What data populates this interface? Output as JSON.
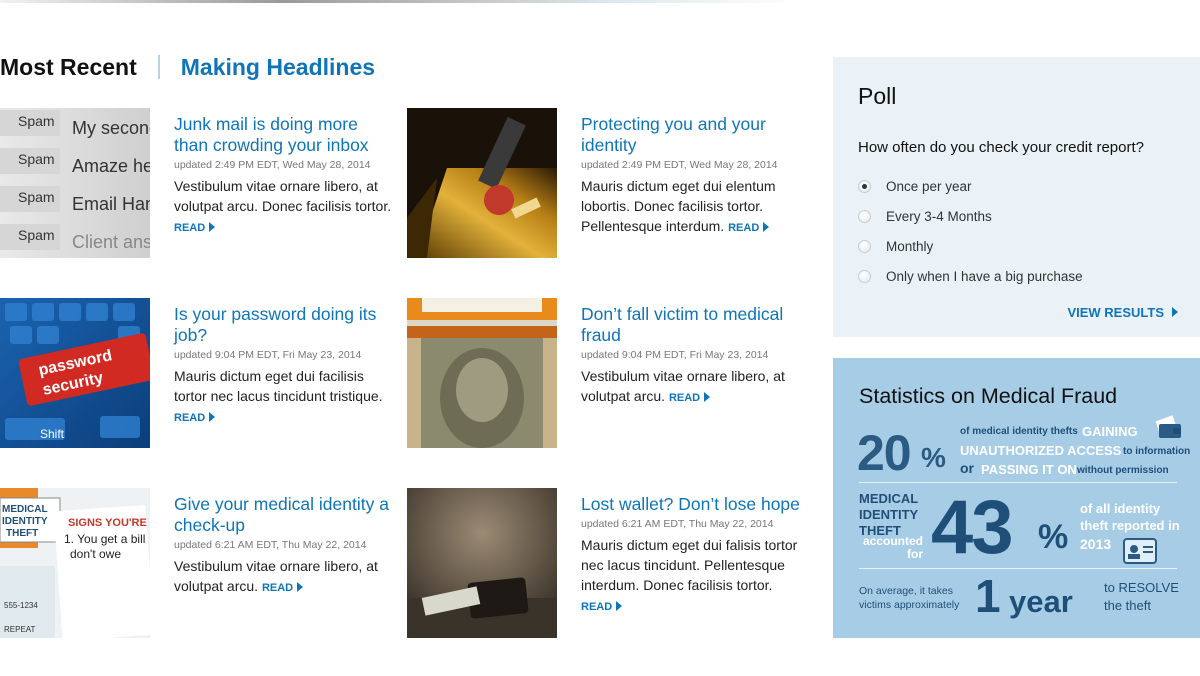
{
  "tabs": {
    "most_recent": "Most Recent",
    "making_headlines": "Making Headlines"
  },
  "articles": [
    {
      "title": "Junk mail is doing more than crowding your inbox",
      "date": "updated 2:49 PM EDT, Wed May 28, 2014",
      "body": "Vestibulum vitae ornare libero, at volutpat arcu. Donec facilisis tortor.",
      "read": "READ",
      "image": {
        "words": [
          "Spam",
          "My second",
          "Spam",
          "Amaze her",
          "Spam",
          "Email Hand",
          "Spam",
          "Client answ"
        ]
      }
    },
    {
      "title": "Protecting you and your identity",
      "date": "updated 2:49 PM EDT, Wed May 28, 2014",
      "body": "Mauris dictum eget dui elentum lobortis. Donec facilisis tortor. Pellentesque interdum.",
      "read": "READ",
      "image": {
        "text": ""
      }
    },
    {
      "title": "Is your password doing its job?",
      "date": "updated 9:04 PM EDT, Fri May 23, 2014",
      "body": "Mauris dictum eget dui facilisis tortor nec lacus tincidunt tristique.",
      "read": "READ",
      "image": {
        "key_top": "password",
        "key_bottom": "security",
        "shift": "Shift"
      }
    },
    {
      "title": "Don’t fall victim to medical fraud",
      "date": "updated 9:04 PM EDT, Fri May 23, 2014",
      "body": "Vestibulum vitae ornare libero, at volutpat arcu.",
      "read": "READ",
      "image": {
        "text": ""
      }
    },
    {
      "title": "Give your medical identity a check-up",
      "date": "updated 6:21 AM EDT, Thu May 22, 2014",
      "body": "Vestibulum vitae ornare libero, at volutpat arcu.",
      "read": "READ",
      "image": {
        "label1": "MEDICAL",
        "label2": "IDENTITY",
        "label3": "THEFT",
        "sign": "SIGNS YOU'RE A",
        "note1": "1. You get a bill",
        "note2": "don't owe",
        "num": "555-1234",
        "repeat": "REPEAT"
      }
    },
    {
      "title": "Lost wallet? Don’t lose hope",
      "date": "updated 6:21 AM EDT, Thu May 22, 2014",
      "body": "Mauris dictum eget dui falisis tortor nec lacus tincidunt. Pellentesque interdum. Donec facilisis tortor.",
      "read": "READ",
      "image": {
        "text": ""
      }
    }
  ],
  "poll": {
    "title": "Poll",
    "question": "How often do you check your credit report?",
    "options": [
      "Once per year",
      "Every 3-4 Months",
      "Monthly",
      "Only when I have a big purchase"
    ],
    "selected": 0,
    "view_results": "VIEW RESULTS"
  },
  "stats": {
    "title": "Statistics on Medical Fraud",
    "stat1": {
      "big": "20",
      "pct": "%",
      "line1": "of medical identity thefts",
      "gaining": "GAINING",
      "unauthorized": "UNAUTHORIZED ACCESS",
      "to_info": "to information",
      "or": "or",
      "passing": "PASSING IT ON",
      "without": "without permission"
    },
    "stat2": {
      "label1": "MEDICAL",
      "label2": "IDENTITY",
      "label3": "THEFT",
      "accounted": "accounted",
      "for": "for",
      "big": "43",
      "pct": "%",
      "right1": "of all identity",
      "right2": "theft reported in",
      "year": "2013"
    },
    "stat3": {
      "left1": "On average, it takes",
      "left2": "victims approximately",
      "big": "1",
      "unit": "year",
      "right1": "to RESOLVE",
      "right2": "the theft"
    }
  },
  "colors": {
    "link": "#0f75b8",
    "poll_bg": "#eaf2f7",
    "stats_bg": "#a7cde6",
    "stats_dark": "#1f4f79"
  }
}
